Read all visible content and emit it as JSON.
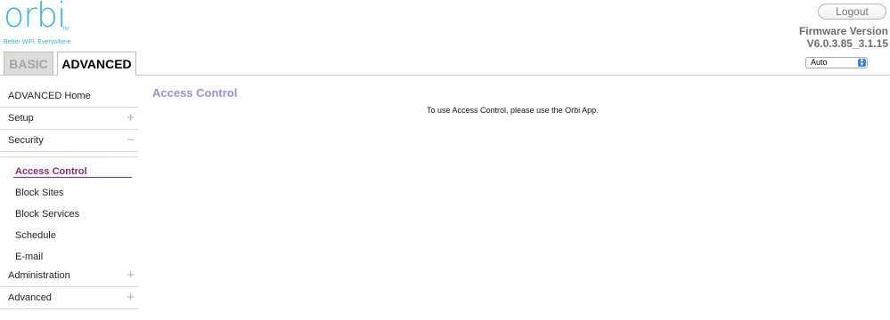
{
  "brand": {
    "logo_text": "orbi",
    "logo_tm": "TM",
    "tagline": "Better WiFi. Everywhere"
  },
  "header": {
    "logout_label": "Logout",
    "firmware_label": "Firmware Version",
    "firmware_version": "V6.0.3.85_3.1.15",
    "language_selected": "Auto"
  },
  "tabs": {
    "basic": "BASIC",
    "advanced": "ADVANCED"
  },
  "sidebar": {
    "home": "ADVANCED Home",
    "setup": "Setup",
    "security": "Security",
    "security_items": [
      "Access Control",
      "Block Sites",
      "Block Services",
      "Schedule",
      "E-mail"
    ],
    "administration": "Administration",
    "advanced": "Advanced",
    "expand_sign": "+",
    "collapse_sign": "−"
  },
  "main": {
    "title": "Access Control",
    "message": "To use Access Control, please use the Orbi App."
  },
  "colors": {
    "brand_blue": "#35b6e8",
    "active_purple": "#8b2b7e",
    "title_lavender": "#9b8fe0"
  }
}
